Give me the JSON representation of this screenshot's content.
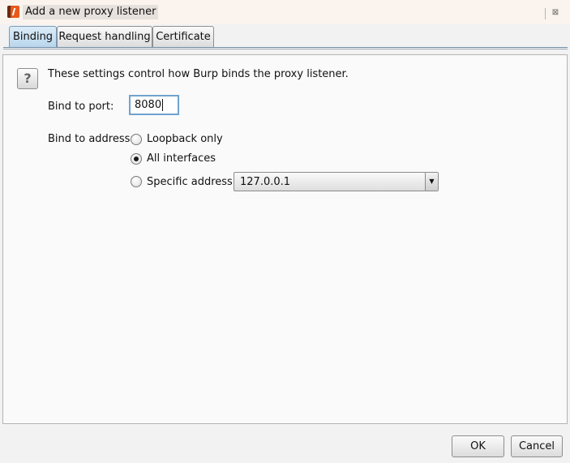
{
  "window": {
    "title": "Add a new proxy listener",
    "icon": "burp-suite-icon",
    "close_glyph": "⊠"
  },
  "tabs": [
    {
      "label": "Binding",
      "active": true
    },
    {
      "label": "Request handling",
      "active": false
    },
    {
      "label": "Certificate",
      "active": false
    }
  ],
  "binding": {
    "help_glyph": "?",
    "description": "These settings control how Burp binds the proxy listener.",
    "port_label": "Bind to port:",
    "port_value": "8080",
    "address_label": "Bind to address:",
    "options": [
      {
        "label": "Loopback only",
        "selected": false
      },
      {
        "label": "All interfaces",
        "selected": true
      },
      {
        "label": "Specific address:",
        "selected": false
      }
    ],
    "specific_address_value": "127.0.0.1"
  },
  "buttons": {
    "ok": "OK",
    "cancel": "Cancel"
  }
}
